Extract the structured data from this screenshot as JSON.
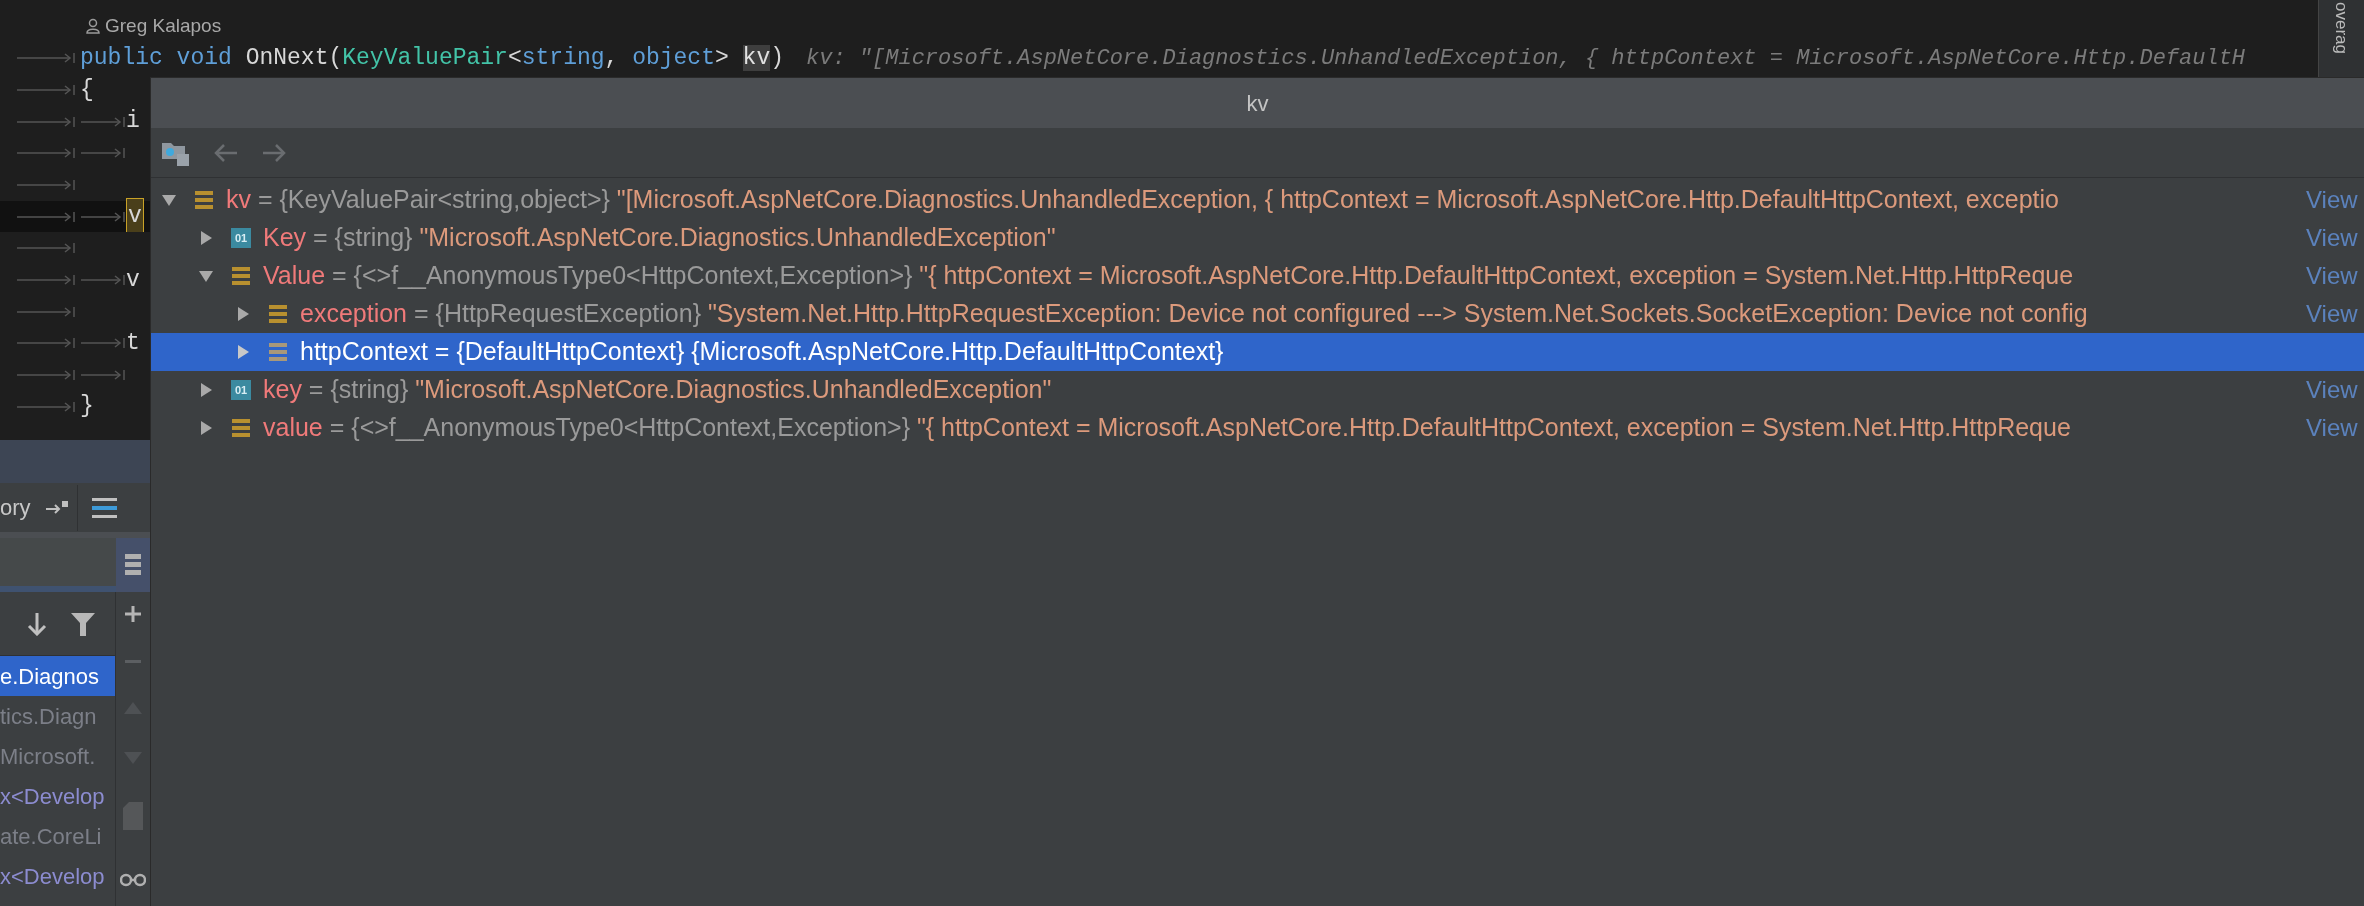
{
  "editor": {
    "author": "Greg Kalapos",
    "signature": [
      {
        "text": "public void ",
        "kind": "keyword"
      },
      {
        "text": "OnNext(",
        "kind": "plain"
      },
      {
        "text": "KeyValuePair",
        "kind": "type"
      },
      {
        "text": "<",
        "kind": "plain"
      },
      {
        "text": "string",
        "kind": "keyword"
      },
      {
        "text": ", ",
        "kind": "plain"
      },
      {
        "text": "object",
        "kind": "keyword"
      },
      {
        "text": "> ",
        "kind": "plain"
      },
      {
        "text": "kv",
        "kind": "param"
      },
      {
        "text": ")",
        "kind": "plain"
      }
    ],
    "inline_hint": "kv: \"[Microsoft.AspNetCore.Diagnostics.UnhandledException, { httpContext = Microsoft.AspNetCore.Http.DefaultH",
    "lines": [
      {
        "text": "{",
        "kind": "brace",
        "current": false
      },
      {
        "text": "i",
        "kind": "statement",
        "current": false
      },
      {
        "kind": "statement",
        "current": false
      },
      {
        "kind": "blank",
        "current": false
      },
      {
        "text": "v",
        "kind": "statement",
        "current": true
      },
      {
        "kind": "blank",
        "current": false
      },
      {
        "text": "v",
        "kind": "statement",
        "current": false
      },
      {
        "kind": "blank",
        "current": false
      },
      {
        "text": "t",
        "kind": "statement",
        "current": false
      },
      {
        "kind": "statement",
        "current": false
      },
      {
        "text": "}",
        "kind": "brace",
        "current": false
      }
    ]
  },
  "side_strip": {
    "label": "overag"
  },
  "popup": {
    "title": "kv",
    "toolbar": [
      {
        "kind": "watch"
      },
      {
        "kind": "back",
        "disabled": true
      },
      {
        "kind": "forward",
        "disabled": true
      }
    ],
    "tree": [
      {
        "name": "kv",
        "operator": "=",
        "type": "{KeyValuePair<string,object>}",
        "value": "\"[Microsoft.AspNetCore.Diagnostics.UnhandledException, { httpContext = Microsoft.AspNetCore.Http.DefaultHttpContext, exceptio",
        "kind": "object",
        "expanded": true,
        "selected": false,
        "link": "View",
        "children": [
          {
            "name": "Key",
            "operator": "=",
            "type": "{string}",
            "value": "\"Microsoft.AspNetCore.Diagnostics.UnhandledException\"",
            "kind": "primitive",
            "badge": "01",
            "expanded": false,
            "selected": false,
            "link": "View"
          },
          {
            "name": "Value",
            "operator": "=",
            "type": "{<>f__AnonymousType0<HttpContext,Exception>}",
            "value": "\"{ httpContext = Microsoft.AspNetCore.Http.DefaultHttpContext, exception = System.Net.Http.HttpReque",
            "kind": "object",
            "expanded": true,
            "selected": false,
            "link": "View",
            "children": [
              {
                "name": "exception",
                "operator": "=",
                "type": "{HttpRequestException}",
                "value": "\"System.Net.Http.HttpRequestException: Device not configured ---> System.Net.Sockets.SocketException: Device not config",
                "kind": "object",
                "expanded": false,
                "selected": false,
                "link": "View"
              },
              {
                "name": "httpContext",
                "operator": "=",
                "type": "{DefaultHttpContext}",
                "value": "{Microsoft.AspNetCore.Http.DefaultHttpContext}",
                "kind": "object",
                "expanded": false,
                "selected": true
              }
            ]
          },
          {
            "name": "key",
            "operator": "=",
            "type": "{string}",
            "value": "\"Microsoft.AspNetCore.Diagnostics.UnhandledException\"",
            "kind": "primitive",
            "badge": "01",
            "expanded": false,
            "selected": false,
            "link": "View"
          },
          {
            "name": "value",
            "operator": "=",
            "type": "{<>f__AnonymousType0<HttpContext,Exception>}",
            "value": "\"{ httpContext = Microsoft.AspNetCore.Http.DefaultHttpContext, exception = System.Net.Http.HttpReque",
            "kind": "object",
            "expanded": false,
            "selected": false,
            "link": "View"
          }
        ]
      }
    ]
  },
  "bottom_panel": {
    "tab": "ory",
    "items": [
      {
        "text": "e.Diagnos",
        "kind": "plain",
        "selected": true
      },
      {
        "text": "tics.Diagn",
        "kind": "plain",
        "selected": false
      },
      {
        "text": "Microsoft.",
        "kind": "plain",
        "selected": false
      },
      {
        "text": "x<Develop",
        "kind": "generic",
        "selected": false
      },
      {
        "text": "ate.CoreLi",
        "kind": "plain",
        "selected": false
      },
      {
        "text": "x<Develop",
        "kind": "generic",
        "selected": false
      }
    ]
  }
}
